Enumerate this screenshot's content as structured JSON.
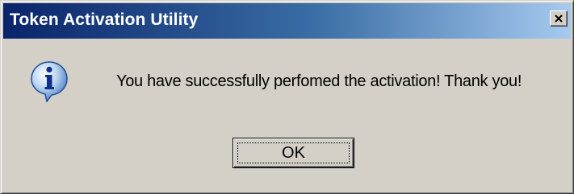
{
  "dialog": {
    "title": "Token Activation Utility",
    "message": "You have successfully perfomed the activation! Thank you!",
    "ok_label": "OK",
    "close_label": "X"
  },
  "icons": {
    "info": "information-icon",
    "close": "close-icon"
  },
  "colors": {
    "titlebar_start": "#0a246a",
    "titlebar_end": "#a6caf0",
    "window_bg": "#d4d0c8"
  }
}
